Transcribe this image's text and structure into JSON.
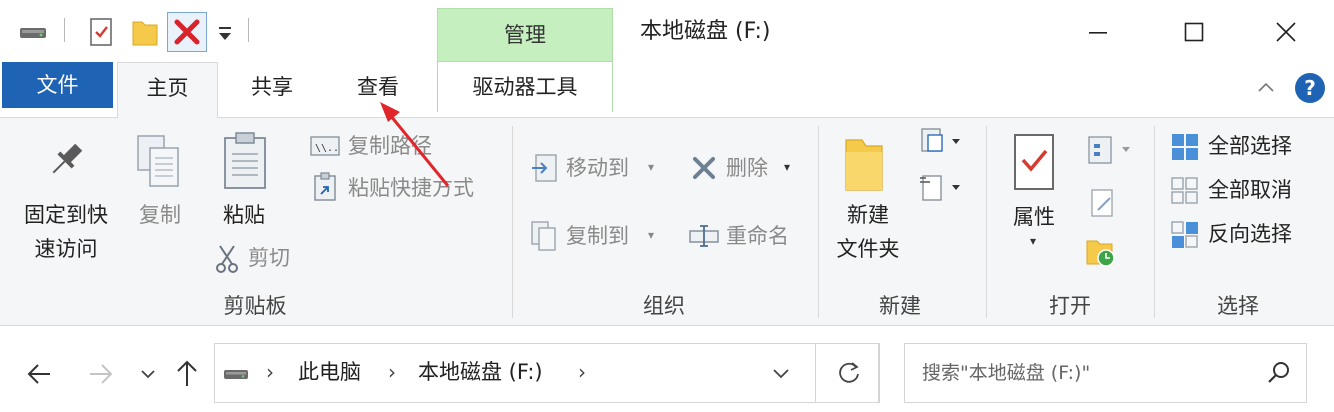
{
  "window": {
    "context_tab": "管理",
    "title": "本地磁盘 (F:)",
    "controls": {
      "minimize": "—",
      "maximize": "☐",
      "close": "✕"
    }
  },
  "tabs": {
    "file": "文件",
    "home": "主页",
    "share": "共享",
    "view": "查看",
    "drive_tools": "驱动器工具"
  },
  "ribbon": {
    "clipboard": {
      "pin": [
        "固定到快",
        "速访问"
      ],
      "copy": "复制",
      "paste": "粘贴",
      "copy_path": "复制路径",
      "paste_shortcut": "粘贴快捷方式",
      "cut": "剪切",
      "group": "剪贴板"
    },
    "organize": {
      "move_to": "移动到",
      "copy_to": "复制到",
      "delete": "删除",
      "rename": "重命名",
      "group": "组织"
    },
    "new": {
      "new_folder": [
        "新建",
        "文件夹"
      ],
      "group": "新建"
    },
    "open": {
      "properties": "属性",
      "group": "打开"
    },
    "select": {
      "select_all": "全部选择",
      "select_none": "全部取消",
      "invert_selection": "反向选择",
      "group": "选择"
    }
  },
  "address": {
    "crumbs": [
      "此电脑",
      "本地磁盘 (F:)"
    ],
    "search_placeholder": "搜索\"本地磁盘 (F:)\""
  },
  "colors": {
    "file_tab": "#1e63b4",
    "context_tab": "#c6efc0",
    "accent_blue": "#1e63b4",
    "arrow_red": "#e0262a"
  }
}
